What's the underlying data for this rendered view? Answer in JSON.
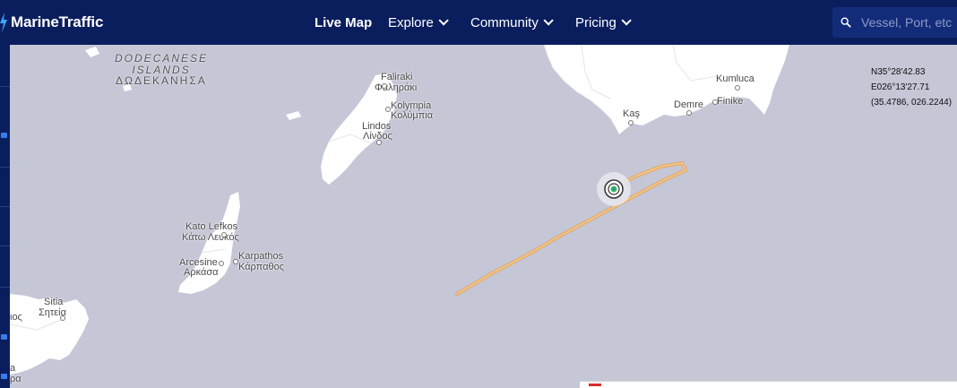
{
  "brand": {
    "name": "MarineTraffic"
  },
  "nav": {
    "live_map": "Live Map",
    "explore": "Explore",
    "community": "Community",
    "pricing": "Pricing"
  },
  "search": {
    "placeholder": "Vessel, Port, etc"
  },
  "coordinates": {
    "lat": "N35°28'42.83",
    "lon": "E026°13'27.71",
    "decimal": "(35.4786, 026.2244)"
  },
  "map": {
    "region_en_1": "DODECANESE",
    "region_en_2": "ISLANDS",
    "region_gr": "ΔΩΔΕΚΑΝΗΣΑ",
    "places": {
      "faliraki": "Faliraki",
      "faliraki_gr": "Φαληράκι",
      "kolympia": "Kolympia",
      "kolympia_gr": "Κολύμπια",
      "lindos": "Lindos",
      "lindos_gr": "Λίνδος",
      "kato_lefkos": "Kato Lefkos",
      "kato_lefkos_gr": "Κάτω Λευκός",
      "arcesine": "Arcesine",
      "arcesine_gr": "Αρκάσα",
      "karpathos": "Karpathos",
      "karpathos_gr": "Κάρπαθος",
      "sitia": "Sitia",
      "sitia_gr": "Σητεία",
      "edge_1": "ιος",
      "edge_2": "a",
      "edge_3": "ρα",
      "kumluca": "Kumluca",
      "kas": "Kaş",
      "demre": "Demre",
      "finike": "Finike"
    },
    "colors": {
      "sea": "#c5c6d6",
      "land": "#ffffff",
      "track": "#f0b35a",
      "header": "#0a1e5e"
    },
    "vessel_icon": "vessel-target-icon"
  }
}
